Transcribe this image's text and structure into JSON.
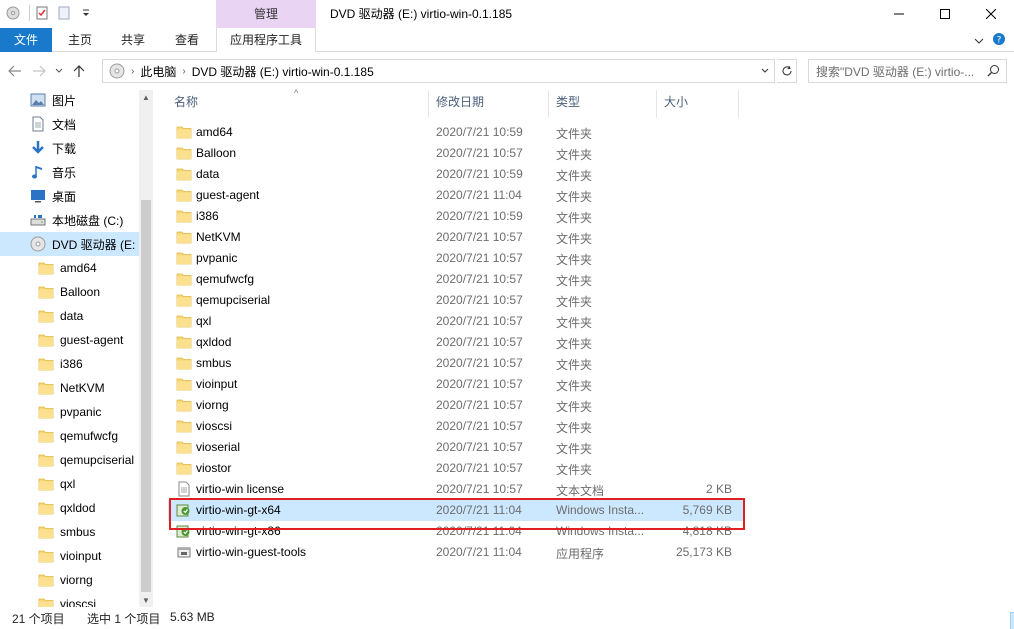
{
  "window": {
    "title": "DVD 驱动器 (E:) virtio-win-0.1.185",
    "context_tab": "管理"
  },
  "ribbon": {
    "tabs": [
      {
        "label": "文件"
      },
      {
        "label": "主页"
      },
      {
        "label": "共享"
      },
      {
        "label": "查看"
      },
      {
        "label": "应用程序工具"
      }
    ]
  },
  "address": {
    "crumbs": [
      "此电脑",
      "DVD 驱动器 (E:) virtio-win-0.1.185"
    ],
    "search_placeholder": "搜索\"DVD 驱动器 (E:) virtio-..."
  },
  "navpane": {
    "items": [
      {
        "label": "图片",
        "icon": "pictures-icon"
      },
      {
        "label": "文档",
        "icon": "documents-icon"
      },
      {
        "label": "下载",
        "icon": "downloads-icon"
      },
      {
        "label": "音乐",
        "icon": "music-icon"
      },
      {
        "label": "桌面",
        "icon": "desktop-icon"
      },
      {
        "label": "本地磁盘 (C:)",
        "icon": "drive-icon"
      },
      {
        "label": "DVD 驱动器 (E:",
        "icon": "dvd-icon",
        "selected": true
      },
      {
        "label": "amd64",
        "icon": "folder-icon"
      },
      {
        "label": "Balloon",
        "icon": "folder-icon"
      },
      {
        "label": "data",
        "icon": "folder-icon"
      },
      {
        "label": "guest-agent",
        "icon": "folder-icon"
      },
      {
        "label": "i386",
        "icon": "folder-icon"
      },
      {
        "label": "NetKVM",
        "icon": "folder-icon"
      },
      {
        "label": "pvpanic",
        "icon": "folder-icon"
      },
      {
        "label": "qemufwcfg",
        "icon": "folder-icon"
      },
      {
        "label": "qemupciserial",
        "icon": "folder-icon"
      },
      {
        "label": "qxl",
        "icon": "folder-icon"
      },
      {
        "label": "qxldod",
        "icon": "folder-icon"
      },
      {
        "label": "smbus",
        "icon": "folder-icon"
      },
      {
        "label": "vioinput",
        "icon": "folder-icon"
      },
      {
        "label": "viorng",
        "icon": "folder-icon"
      },
      {
        "label": "vioscsi",
        "icon": "folder-icon"
      }
    ]
  },
  "columns": {
    "name": "名称",
    "date": "修改日期",
    "type": "类型",
    "size": "大小"
  },
  "files": [
    {
      "name": "amd64",
      "date": "2020/7/21 10:59",
      "type": "文件夹",
      "size": "",
      "icon": "folder-icon"
    },
    {
      "name": "Balloon",
      "date": "2020/7/21 10:57",
      "type": "文件夹",
      "size": "",
      "icon": "folder-icon"
    },
    {
      "name": "data",
      "date": "2020/7/21 10:59",
      "type": "文件夹",
      "size": "",
      "icon": "folder-icon"
    },
    {
      "name": "guest-agent",
      "date": "2020/7/21 11:04",
      "type": "文件夹",
      "size": "",
      "icon": "folder-icon"
    },
    {
      "name": "i386",
      "date": "2020/7/21 10:59",
      "type": "文件夹",
      "size": "",
      "icon": "folder-icon"
    },
    {
      "name": "NetKVM",
      "date": "2020/7/21 10:57",
      "type": "文件夹",
      "size": "",
      "icon": "folder-icon"
    },
    {
      "name": "pvpanic",
      "date": "2020/7/21 10:57",
      "type": "文件夹",
      "size": "",
      "icon": "folder-icon"
    },
    {
      "name": "qemufwcfg",
      "date": "2020/7/21 10:57",
      "type": "文件夹",
      "size": "",
      "icon": "folder-icon"
    },
    {
      "name": "qemupciserial",
      "date": "2020/7/21 10:57",
      "type": "文件夹",
      "size": "",
      "icon": "folder-icon"
    },
    {
      "name": "qxl",
      "date": "2020/7/21 10:57",
      "type": "文件夹",
      "size": "",
      "icon": "folder-icon"
    },
    {
      "name": "qxldod",
      "date": "2020/7/21 10:57",
      "type": "文件夹",
      "size": "",
      "icon": "folder-icon"
    },
    {
      "name": "smbus",
      "date": "2020/7/21 10:57",
      "type": "文件夹",
      "size": "",
      "icon": "folder-icon"
    },
    {
      "name": "vioinput",
      "date": "2020/7/21 10:57",
      "type": "文件夹",
      "size": "",
      "icon": "folder-icon"
    },
    {
      "name": "viorng",
      "date": "2020/7/21 10:57",
      "type": "文件夹",
      "size": "",
      "icon": "folder-icon"
    },
    {
      "name": "vioscsi",
      "date": "2020/7/21 10:57",
      "type": "文件夹",
      "size": "",
      "icon": "folder-icon"
    },
    {
      "name": "vioserial",
      "date": "2020/7/21 10:57",
      "type": "文件夹",
      "size": "",
      "icon": "folder-icon"
    },
    {
      "name": "viostor",
      "date": "2020/7/21 10:57",
      "type": "文件夹",
      "size": "",
      "icon": "folder-icon"
    },
    {
      "name": "virtio-win license",
      "date": "2020/7/21 10:57",
      "type": "文本文档",
      "size": "2 KB",
      "icon": "text-file-icon"
    },
    {
      "name": "virtio-win-gt-x64",
      "date": "2020/7/21 11:04",
      "type": "Windows Insta...",
      "size": "5,769 KB",
      "icon": "installer-icon",
      "selected": true
    },
    {
      "name": "virtio-win-gt-x86",
      "date": "2020/7/21 11:04",
      "type": "Windows Insta...",
      "size": "4,818 KB",
      "icon": "installer-icon"
    },
    {
      "name": "virtio-win-guest-tools",
      "date": "2020/7/21 11:04",
      "type": "应用程序",
      "size": "25,173 KB",
      "icon": "application-icon"
    }
  ],
  "status": {
    "count": "21 个项目",
    "selected": "选中 1 个项目",
    "size": "5.63 MB"
  },
  "colors": {
    "accent": "#1979ca",
    "selection": "#cce8ff",
    "context_tab": "#e9d4f4",
    "highlight_box": "#e02020",
    "folder": "#f8d775"
  }
}
